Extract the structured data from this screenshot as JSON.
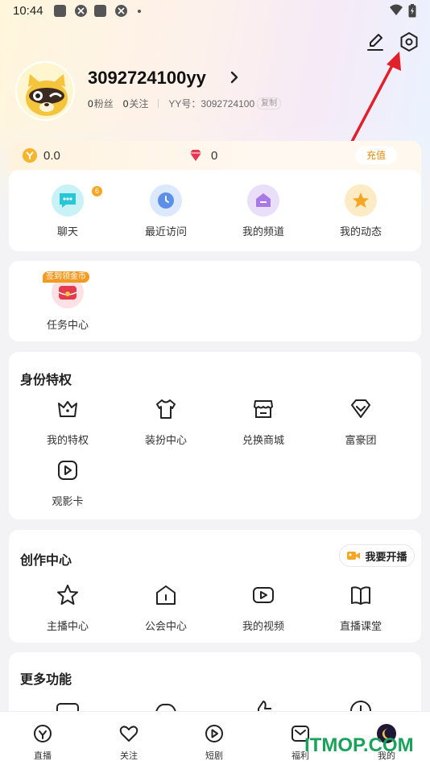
{
  "status_bar": {
    "time": "10:44"
  },
  "profile": {
    "username": "3092724100yy",
    "fans_count": "0",
    "fans_label": "粉丝",
    "follow_count": "0",
    "follow_label": "关注",
    "yy_label": "YY号：3092724100",
    "copy_label": "复制"
  },
  "wallet": {
    "coins": "0.0",
    "diamonds": "0",
    "recharge": "充值"
  },
  "quick": {
    "items": [
      {
        "label": "聊天",
        "badge": "6"
      },
      {
        "label": "最近访问"
      },
      {
        "label": "我的频道"
      },
      {
        "label": "我的动态"
      }
    ]
  },
  "task": {
    "tag": "签到领金币",
    "label": "任务中心"
  },
  "identity": {
    "title": "身份特权",
    "items": [
      {
        "label": "我的特权"
      },
      {
        "label": "装扮中心"
      },
      {
        "label": "兑换商城"
      },
      {
        "label": "富豪团"
      },
      {
        "label": "观影卡"
      }
    ]
  },
  "creator": {
    "title": "创作中心",
    "live_button": "我要开播",
    "items": [
      {
        "label": "主播中心"
      },
      {
        "label": "公会中心"
      },
      {
        "label": "我的视频"
      },
      {
        "label": "直播课堂"
      }
    ]
  },
  "more": {
    "title": "更多功能"
  },
  "bottom_nav": {
    "items": [
      {
        "label": "直播"
      },
      {
        "label": "关注"
      },
      {
        "label": "短剧"
      },
      {
        "label": "福利"
      },
      {
        "label": "我的"
      }
    ]
  },
  "watermark": "ITMOP.COM",
  "colors": {
    "accent": "#f39a21",
    "diamond": "#e8384f",
    "arrow": "#e0202a"
  }
}
